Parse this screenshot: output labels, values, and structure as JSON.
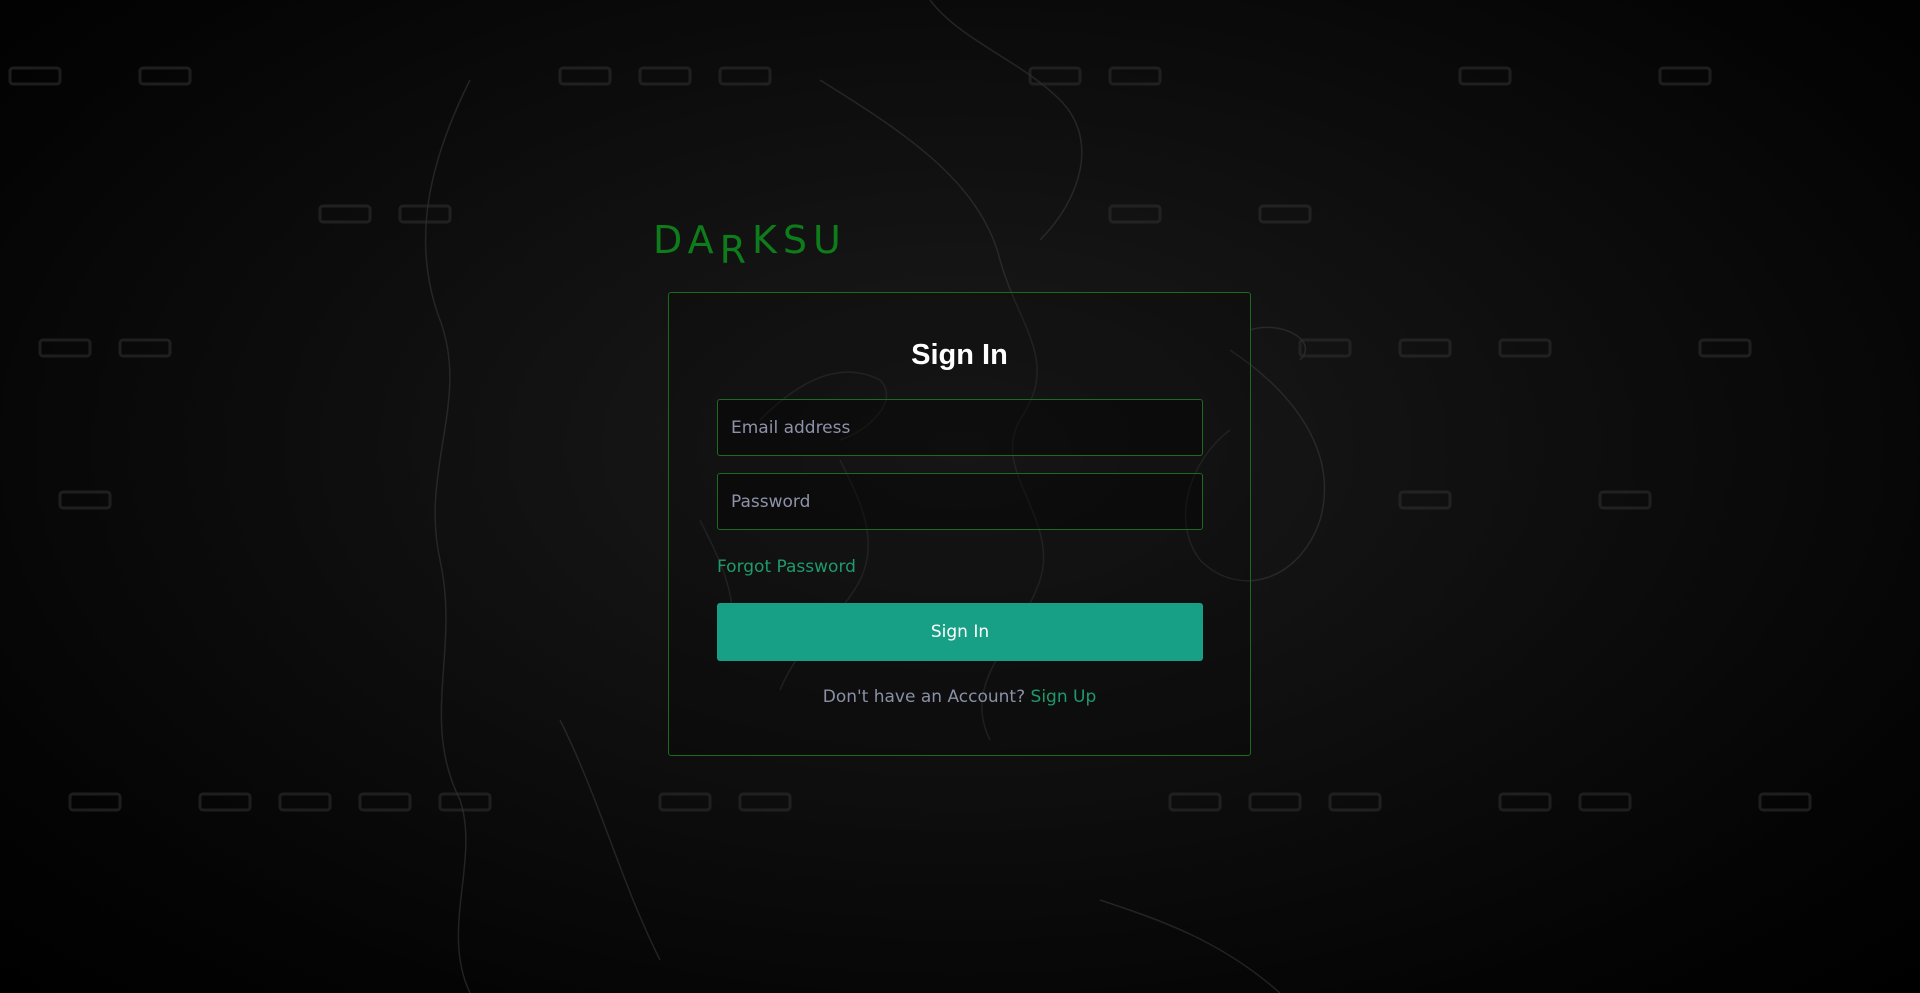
{
  "logo": {
    "part1": "DA",
    "part2": "R",
    "part3": "KSU",
    "color": "#0e7c1a"
  },
  "signin": {
    "title": "Sign In",
    "email_placeholder": "Email address",
    "password_placeholder": "Password",
    "forgot_label": "Forgot Password",
    "button_label": "Sign In",
    "no_account_text": "Don't have an Account?",
    "signup_label": "Sign Up"
  },
  "colors": {
    "accent_green": "#17a085",
    "link_green": "#1e9a6d",
    "border_green": "#1b6b1f",
    "background": "#050505"
  }
}
